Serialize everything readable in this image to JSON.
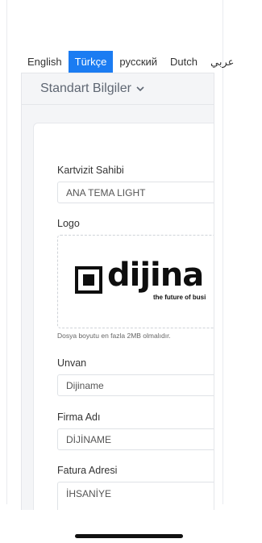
{
  "languages": {
    "tabs": [
      {
        "label": "English",
        "active": false
      },
      {
        "label": "Türkçe",
        "active": true
      },
      {
        "label": "русский",
        "active": false
      },
      {
        "label": "Dutch",
        "active": false
      },
      {
        "label": "عربي",
        "active": false
      }
    ]
  },
  "section": {
    "title": "Standart Bilgiler",
    "chevron_icon": "chevron-down-icon"
  },
  "form": {
    "owner_label": "Kartvizit Sahibi",
    "owner_value": "ANA TEMA LIGHT",
    "logo_label": "Logo",
    "logo_text": "dijina",
    "logo_tagline": "the future of busi",
    "upload_hint": "Dosya boyutu en fazla 2MB olmalıdır.",
    "title_label": "Unvan",
    "title_placeholder": "Dijiname",
    "company_label": "Firma Adı",
    "company_value": "DİJİNAME",
    "address_label": "Fatura Adresi",
    "address_value": "İHSANİYE"
  },
  "colors": {
    "accent": "#1b7cf2"
  }
}
